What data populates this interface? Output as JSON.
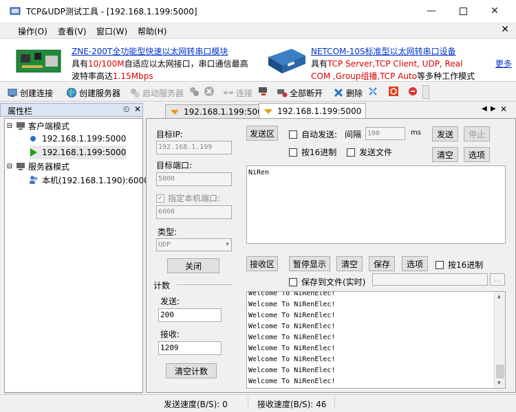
{
  "window": {
    "title": "TCP&UDP测试工具 - [192.168.1.199:5000]"
  },
  "menu": {
    "items": [
      "操作(O)",
      "查看(V)",
      "窗口(W)",
      "帮助(H)"
    ]
  },
  "banner": {
    "ad1": {
      "title": "ZNE-200T全功能型快速以太网转串口模块",
      "line2_a": "具有",
      "line2_red": "10/100M",
      "line2_b": "自适应以太网接口，串口通信最高",
      "line3_a": "波特率高达",
      "line3_red": "1.15Mbps"
    },
    "ad2": {
      "title": "NETCOM-10S标准型以太网转串口设备",
      "line2_a": "具有",
      "line2_red": "TCP Server,TCP Client, UDP, Real",
      "line3_red": "COM ,Group组播,TCP Auto",
      "line3_b": "等多种工作模式"
    },
    "more": "更多"
  },
  "toolbar": {
    "create_conn": "创建连接",
    "create_server": "创建服务器",
    "start_server": "启动服务器",
    "connect": "连接",
    "disconnect_all": "全部断开",
    "delete": "删除"
  },
  "sidebar": {
    "title": "属性栏",
    "pin": "ᵖ",
    "client_mode": "客户端模式",
    "client_items": [
      "192.168.1.199:5000",
      "192.168.1.199:5000"
    ],
    "server_mode": "服务器模式",
    "server_item": "本机(192.168.1.190):6000"
  },
  "tabs": [
    "192.168.1.199:5000",
    "192.168.1.199:5000"
  ],
  "conn": {
    "target_ip_label": "目标IP:",
    "target_ip": "192.168.1.199",
    "target_port_label": "目标端口:",
    "target_port": "5000",
    "local_port_label": "指定本机端口:",
    "local_port": "6000",
    "type_label": "类型:",
    "type": "UDP",
    "close_btn": "关闭",
    "count_label": "计数",
    "send_label": "发送:",
    "send_count": "200",
    "recv_label": "接收:",
    "recv_count": "1209",
    "clear_count_btn": "清空计数"
  },
  "send": {
    "area_btn": "发送区",
    "auto_send": "自动发送:",
    "interval_label": "间隔",
    "interval": "100",
    "ms": "ms",
    "send_btn": "发送",
    "stop_btn": "停止",
    "hex": "按16进制",
    "send_file": "发送文件",
    "clear_btn": "清空",
    "options_btn": "选项",
    "text": "NiRen"
  },
  "recv": {
    "area_btn": "接收区",
    "pause_btn": "暂停显示",
    "clear_btn": "清空",
    "save_btn": "保存",
    "options_btn": "选项",
    "hex": "按16进制",
    "save_file": "保存到文件(实时)",
    "browse": "...",
    "lines": [
      "Welcome To NiRenElec!",
      "Welcome To NiRenElec!",
      "Welcome To NiRenElec!",
      "Welcome To NiRenElec!",
      "Welcome To NiRenElec!",
      "Welcome To NiRenElec!",
      "Welcome To NiRenElec!",
      "Welcome To NiRenElec!",
      "Welcome To NiRenElec!"
    ]
  },
  "status": {
    "send_speed": "发送速度(B/S): 0",
    "recv_speed": "接收速度(B/S): 46"
  }
}
